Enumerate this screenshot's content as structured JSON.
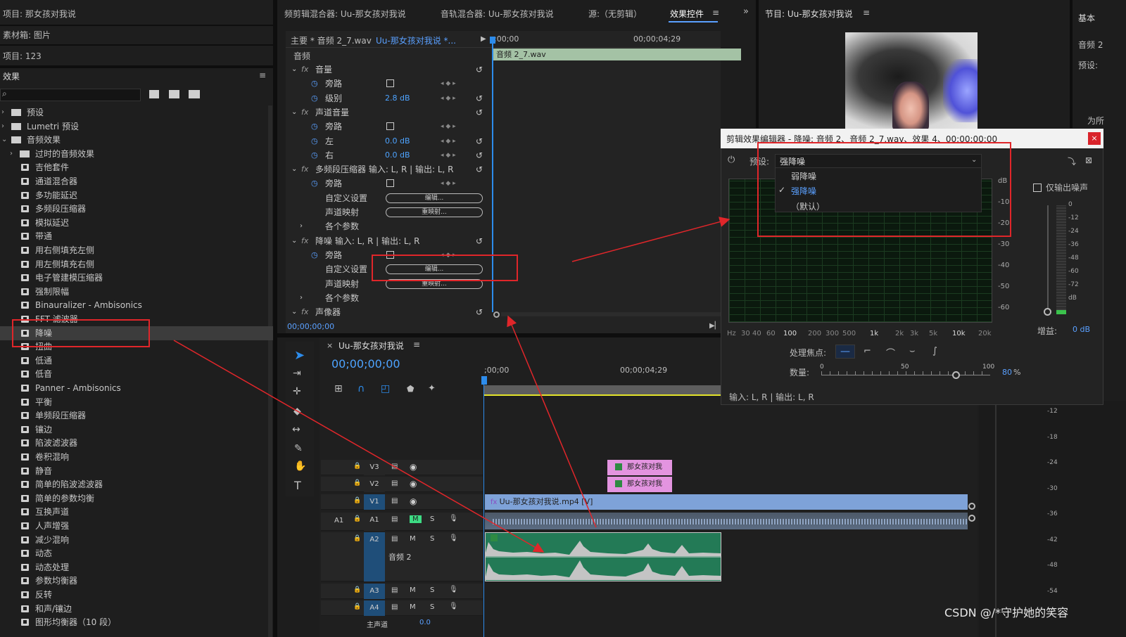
{
  "project": {
    "title": "项目: 那女孩对我说",
    "bin": "素材箱: 图片",
    "items": "项目: 123"
  },
  "effects": {
    "title": "效果",
    "search_placeholder": "",
    "tree": [
      {
        "label": "预设",
        "type": "folder",
        "level": 0
      },
      {
        "label": "Lumetri 预设",
        "type": "folder",
        "level": 0
      },
      {
        "label": "音频效果",
        "type": "folder-open",
        "level": 0
      },
      {
        "label": "过时的音频效果",
        "type": "folder",
        "level": 1
      },
      {
        "label": "吉他套件",
        "type": "fx"
      },
      {
        "label": "通道混合器",
        "type": "fx"
      },
      {
        "label": "多功能延迟",
        "type": "fx"
      },
      {
        "label": "多频段压缩器",
        "type": "fx"
      },
      {
        "label": "模拟延迟",
        "type": "fx"
      },
      {
        "label": "带通",
        "type": "fx"
      },
      {
        "label": "用右侧填充左侧",
        "type": "fx"
      },
      {
        "label": "用左侧填充右侧",
        "type": "fx"
      },
      {
        "label": "电子管建模压缩器",
        "type": "fx"
      },
      {
        "label": "强制限幅",
        "type": "fx"
      },
      {
        "label": "Binauralizer - Ambisonics",
        "type": "fx"
      },
      {
        "label": "FFT 滤波器",
        "type": "fx"
      },
      {
        "label": "降噪",
        "type": "fx",
        "selected": true
      },
      {
        "label": "扭曲",
        "type": "fx"
      },
      {
        "label": "低通",
        "type": "fx"
      },
      {
        "label": "低音",
        "type": "fx"
      },
      {
        "label": "Panner - Ambisonics",
        "type": "fx"
      },
      {
        "label": "平衡",
        "type": "fx"
      },
      {
        "label": "单频段压缩器",
        "type": "fx"
      },
      {
        "label": "镶边",
        "type": "fx"
      },
      {
        "label": "陷波滤波器",
        "type": "fx"
      },
      {
        "label": "卷积混响",
        "type": "fx"
      },
      {
        "label": "静音",
        "type": "fx"
      },
      {
        "label": "简单的陷波滤波器",
        "type": "fx"
      },
      {
        "label": "简单的参数均衡",
        "type": "fx"
      },
      {
        "label": "互换声道",
        "type": "fx"
      },
      {
        "label": "人声增强",
        "type": "fx"
      },
      {
        "label": "减少混响",
        "type": "fx"
      },
      {
        "label": "动态",
        "type": "fx"
      },
      {
        "label": "动态处理",
        "type": "fx"
      },
      {
        "label": "参数均衡器",
        "type": "fx"
      },
      {
        "label": "反转",
        "type": "fx"
      },
      {
        "label": "和声/镶边",
        "type": "fx"
      },
      {
        "label": "图形均衡器（10 段）",
        "type": "fx"
      }
    ]
  },
  "tabs": {
    "clip_mixer": "频剪辑混合器: Uu-那女孩对我说",
    "audio_mixer": "音轨混合器: Uu-那女孩对我说",
    "source": "源:（无剪辑）",
    "effect_controls": "效果控件",
    "program": "节目: Uu-那女孩对我说",
    "basic": "基本"
  },
  "ec": {
    "master": "主要 * 音频 2_7.wav",
    "seq": "Uu-那女孩对我说 *...",
    "audio_header": "音频",
    "clip_name": "音频 2_7.wav",
    "tc_start": ";00;00",
    "tc_mid": "00;00;04;29",
    "timecode": "00;00;00;00",
    "rows": [
      {
        "k": "fx",
        "label": "音量"
      },
      {
        "k": "p",
        "label": "旁路",
        "chk": true
      },
      {
        "k": "p",
        "label": "级别",
        "val": "2.8 dB"
      },
      {
        "k": "fx",
        "label": "声道音量"
      },
      {
        "k": "p",
        "label": "旁路",
        "chk": true
      },
      {
        "k": "p",
        "label": "左",
        "val": "0.0 dB"
      },
      {
        "k": "p",
        "label": "右",
        "val": "0.0 dB"
      },
      {
        "k": "fx",
        "label": "多频段压缩器 输入: L, R | 输出: L, R"
      },
      {
        "k": "p",
        "label": "旁路",
        "chk": true
      },
      {
        "k": "p",
        "label": "自定义设置",
        "btn": "编辑..."
      },
      {
        "k": "p",
        "label": "声道映射",
        "btn": "重映射..."
      },
      {
        "k": "p",
        "label": "各个参数"
      },
      {
        "k": "fx",
        "label": "降噪 输入: L, R | 输出: L, R"
      },
      {
        "k": "p",
        "label": "旁路",
        "chk": true
      },
      {
        "k": "p",
        "label": "自定义设置",
        "btn": "编辑..."
      },
      {
        "k": "p",
        "label": "声道映射",
        "btn": "重映射..."
      },
      {
        "k": "p",
        "label": "各个参数"
      },
      {
        "k": "fx",
        "label": "声像器"
      }
    ]
  },
  "timeline": {
    "title": "Uu-那女孩对我说",
    "timecode": "00;00;00;00",
    "ruler_start": ";00;00",
    "ruler_mid": "00;00;04;29",
    "tracks": [
      {
        "id": "V3",
        "clip": "那女孩对我"
      },
      {
        "id": "V2",
        "clip": "那女孩对我"
      },
      {
        "id": "V1",
        "clip": "Uu-那女孩对我说.mp4 [V]"
      },
      {
        "id": "A1",
        "src": "A1"
      },
      {
        "id": "A2",
        "name": "音频 2"
      },
      {
        "id": "A3"
      },
      {
        "id": "A4"
      }
    ],
    "master": "主声道",
    "master_val": "0.0"
  },
  "dialog": {
    "title": "剪辑效果编辑器 - 降噪: 音频 2、音频 2_7.wav、效果 4、00;00;00;00",
    "preset_label": "预设:",
    "preset_value": "强降噪",
    "options": [
      "弱降噪",
      "强降噪",
      "（默认）"
    ],
    "selected_option": "强降噪",
    "output_noise": "仅输出噪声",
    "db_ticks": [
      "dB",
      "-10",
      "-20",
      "-30",
      "-40",
      "-50",
      "-60"
    ],
    "hz_ticks": [
      "Hz",
      "30",
      "40",
      "60",
      "100",
      "200",
      "300",
      "500",
      "1k",
      "2k",
      "3k",
      "5k",
      "10k",
      "20k"
    ],
    "meter_ticks": [
      "0",
      "-12",
      "-24",
      "-36",
      "-48",
      "-60",
      "-72",
      "dB"
    ],
    "gain_label": "增益:",
    "gain_value": "0 dB",
    "focus_label": "处理焦点:",
    "amount_label": "数量:",
    "amount_ticks": [
      "0",
      "50",
      "100"
    ],
    "amount_value": "80",
    "amount_unit": "%",
    "io": "输入: L, R | 输出: L, R",
    "amount_fraction": 0.8
  },
  "program": {
    "label1": "音频 2",
    "label2": "预设:",
    "label3": "为所"
  },
  "meters": [
    "-12",
    "-18",
    "-24",
    "-30",
    "-36",
    "-42",
    "-48",
    "-54"
  ],
  "watermark": "CSDN @/*守护她的笑容"
}
